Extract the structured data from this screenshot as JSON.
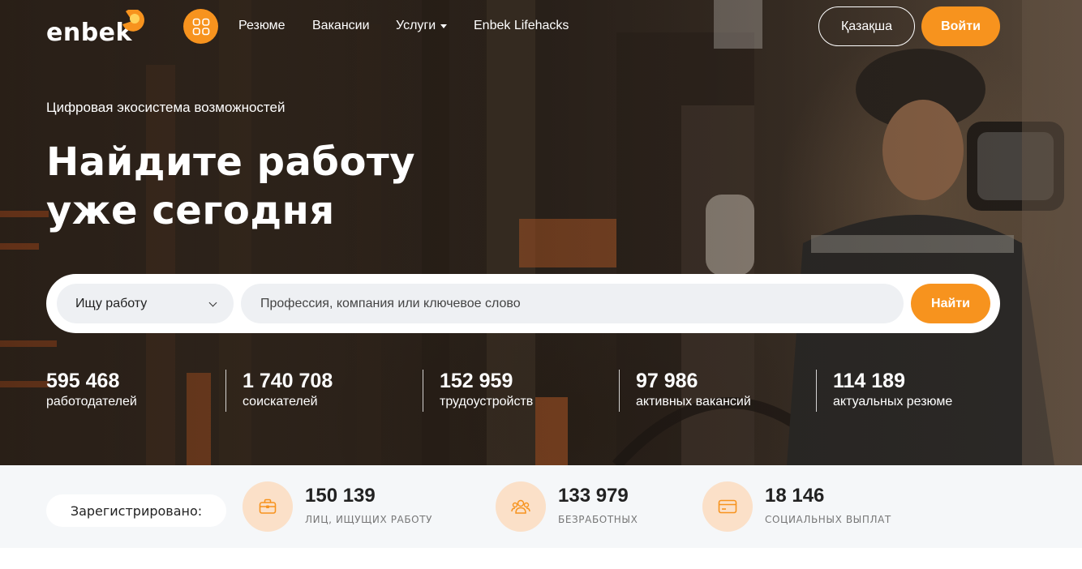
{
  "colors": {
    "accent": "#f7931e",
    "icon_bg": "#fbe0c8",
    "band_bg": "#f5f7f9"
  },
  "header": {
    "logo_text": "enbek",
    "apps_icon": "grid-icon",
    "nav": [
      {
        "label": "Резюме"
      },
      {
        "label": "Вакансии"
      },
      {
        "label": "Услуги"
      },
      {
        "label": "Enbek Lifehacks"
      }
    ],
    "lang_label": "Қазақша",
    "login_label": "Войти"
  },
  "hero": {
    "tagline": "Цифровая экосистема возможностей",
    "headline_line1": "Найдите работу",
    "headline_line2": "уже сегодня"
  },
  "search": {
    "mode_value": "Ищу работу",
    "placeholder": "Профессия, компания или ключевое слово",
    "button_label": "Найти"
  },
  "stats": [
    {
      "value": "595 468",
      "label": "работодателей"
    },
    {
      "value": "1 740 708",
      "label": "соискателей"
    },
    {
      "value": "152 959",
      "label": "трудоустройств"
    },
    {
      "value": "97 986",
      "label": "активных вакансий"
    },
    {
      "value": "114 189",
      "label": "актуальных резюме"
    }
  ],
  "registered": {
    "label": "Зарегистрировано:",
    "items": [
      {
        "icon": "briefcase-icon",
        "value": "150 139",
        "label": "лиц, ищущих работу"
      },
      {
        "icon": "people-icon",
        "value": "133 979",
        "label": "безработных"
      },
      {
        "icon": "card-icon",
        "value": "18 146",
        "label": "социальных выплат"
      }
    ]
  }
}
